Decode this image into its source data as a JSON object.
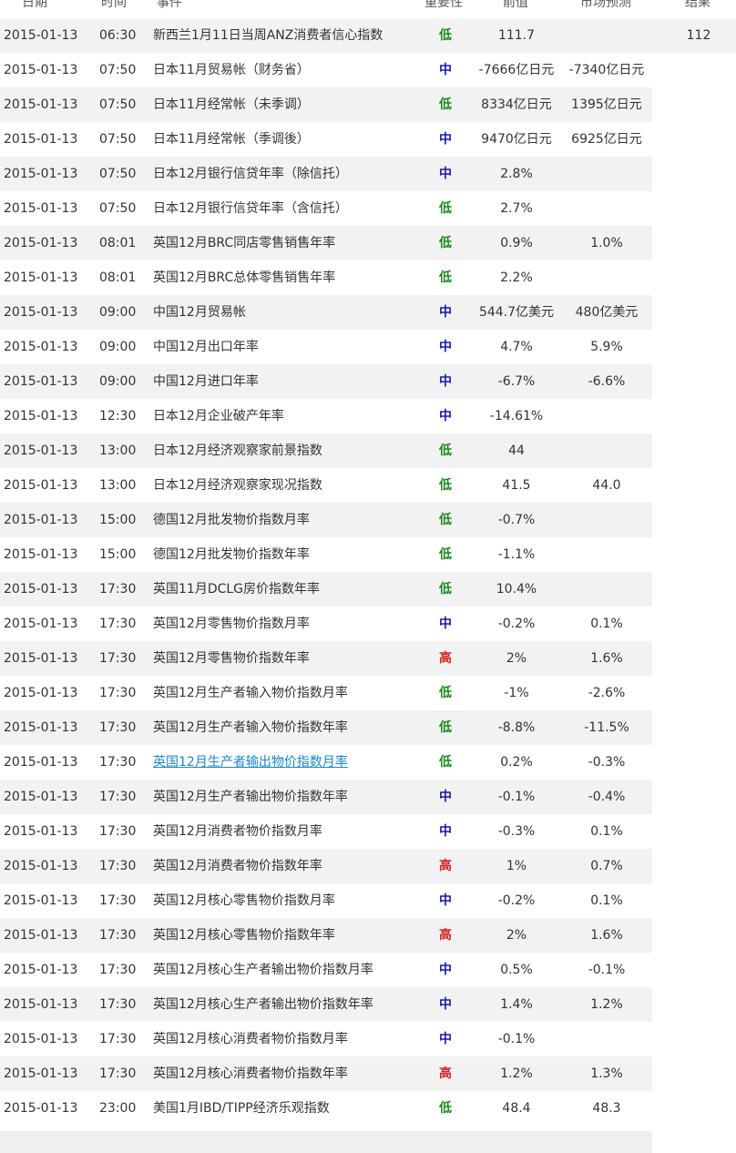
{
  "header": {
    "date": "日期",
    "time": "时间",
    "event": "事件",
    "importance": "重要性",
    "previous": "前值",
    "forecast": "市场预测",
    "actual": "结果"
  },
  "colors": {
    "low": "#1a8a1a",
    "mid": "#1a1aa6",
    "high": "#d42020",
    "link": "#1a88c9",
    "stripe": "#f2f2f2"
  },
  "rows": [
    {
      "date": "2015-01-13",
      "time": "06:30",
      "event": "新西兰1月11日当周ANZ消费者信心指数",
      "importance": "低",
      "level": "low",
      "previous": "111.7",
      "forecast": "",
      "actual": "112"
    },
    {
      "date": "2015-01-13",
      "time": "07:50",
      "event": "日本11月贸易帐（财务省）",
      "importance": "中",
      "level": "mid",
      "previous": "-7666亿日元",
      "forecast": "-7340亿日元",
      "actual": ""
    },
    {
      "date": "2015-01-13",
      "time": "07:50",
      "event": "日本11月经常帐（未季调）",
      "importance": "低",
      "level": "low",
      "previous": "8334亿日元",
      "forecast": "1395亿日元",
      "actual": ""
    },
    {
      "date": "2015-01-13",
      "time": "07:50",
      "event": "日本11月经常帐（季调後）",
      "importance": "中",
      "level": "mid",
      "previous": "9470亿日元",
      "forecast": "6925亿日元",
      "actual": ""
    },
    {
      "date": "2015-01-13",
      "time": "07:50",
      "event": "日本12月银行信贷年率（除信托）",
      "importance": "中",
      "level": "mid",
      "previous": "2.8%",
      "forecast": "",
      "actual": ""
    },
    {
      "date": "2015-01-13",
      "time": "07:50",
      "event": "日本12月银行信贷年率（含信托）",
      "importance": "低",
      "level": "low",
      "previous": "2.7%",
      "forecast": "",
      "actual": ""
    },
    {
      "date": "2015-01-13",
      "time": "08:01",
      "event": "英国12月BRC同店零售销售年率",
      "importance": "低",
      "level": "low",
      "previous": "0.9%",
      "forecast": "1.0%",
      "actual": ""
    },
    {
      "date": "2015-01-13",
      "time": "08:01",
      "event": "英国12月BRC总体零售销售年率",
      "importance": "低",
      "level": "low",
      "previous": "2.2%",
      "forecast": "",
      "actual": ""
    },
    {
      "date": "2015-01-13",
      "time": "09:00",
      "event": "中国12月贸易帐",
      "importance": "中",
      "level": "mid",
      "previous": "544.7亿美元",
      "forecast": "480亿美元",
      "actual": ""
    },
    {
      "date": "2015-01-13",
      "time": "09:00",
      "event": "中国12月出口年率",
      "importance": "中",
      "level": "mid",
      "previous": "4.7%",
      "forecast": "5.9%",
      "actual": ""
    },
    {
      "date": "2015-01-13",
      "time": "09:00",
      "event": "中国12月进口年率",
      "importance": "中",
      "level": "mid",
      "previous": "-6.7%",
      "forecast": "-6.6%",
      "actual": ""
    },
    {
      "date": "2015-01-13",
      "time": "12:30",
      "event": "日本12月企业破产年率",
      "importance": "中",
      "level": "mid",
      "previous": "-14.61%",
      "forecast": "",
      "actual": ""
    },
    {
      "date": "2015-01-13",
      "time": "13:00",
      "event": "日本12月经济观察家前景指数",
      "importance": "低",
      "level": "low",
      "previous": "44",
      "forecast": "",
      "actual": ""
    },
    {
      "date": "2015-01-13",
      "time": "13:00",
      "event": "日本12月经济观察家现况指数",
      "importance": "低",
      "level": "low",
      "previous": "41.5",
      "forecast": "44.0",
      "actual": ""
    },
    {
      "date": "2015-01-13",
      "time": "15:00",
      "event": "德国12月批发物价指数月率",
      "importance": "低",
      "level": "low",
      "previous": "-0.7%",
      "forecast": "",
      "actual": ""
    },
    {
      "date": "2015-01-13",
      "time": "15:00",
      "event": "德国12月批发物价指数年率",
      "importance": "低",
      "level": "low",
      "previous": "-1.1%",
      "forecast": "",
      "actual": ""
    },
    {
      "date": "2015-01-13",
      "time": "17:30",
      "event": "英国11月DCLG房价指数年率",
      "importance": "低",
      "level": "low",
      "previous": "10.4%",
      "forecast": "",
      "actual": ""
    },
    {
      "date": "2015-01-13",
      "time": "17:30",
      "event": "英国12月零售物价指数月率",
      "importance": "中",
      "level": "mid",
      "previous": "-0.2%",
      "forecast": "0.1%",
      "actual": ""
    },
    {
      "date": "2015-01-13",
      "time": "17:30",
      "event": "英国12月零售物价指数年率",
      "importance": "高",
      "level": "high",
      "previous": "2%",
      "forecast": "1.6%",
      "actual": ""
    },
    {
      "date": "2015-01-13",
      "time": "17:30",
      "event": "英国12月生产者输入物价指数月率",
      "importance": "低",
      "level": "low",
      "previous": "-1%",
      "forecast": "-2.6%",
      "actual": ""
    },
    {
      "date": "2015-01-13",
      "time": "17:30",
      "event": "英国12月生产者输入物价指数年率",
      "importance": "低",
      "level": "low",
      "previous": "-8.8%",
      "forecast": "-11.5%",
      "actual": ""
    },
    {
      "date": "2015-01-13",
      "time": "17:30",
      "event": "英国12月生产者输出物价指数月率",
      "importance": "低",
      "level": "low",
      "previous": "0.2%",
      "forecast": "-0.3%",
      "actual": "",
      "link": true
    },
    {
      "date": "2015-01-13",
      "time": "17:30",
      "event": "英国12月生产者输出物价指数年率",
      "importance": "中",
      "level": "mid",
      "previous": "-0.1%",
      "forecast": "-0.4%",
      "actual": ""
    },
    {
      "date": "2015-01-13",
      "time": "17:30",
      "event": "英国12月消费者物价指数月率",
      "importance": "中",
      "level": "mid",
      "previous": "-0.3%",
      "forecast": "0.1%",
      "actual": ""
    },
    {
      "date": "2015-01-13",
      "time": "17:30",
      "event": "英国12月消费者物价指数年率",
      "importance": "高",
      "level": "high",
      "previous": "1%",
      "forecast": "0.7%",
      "actual": ""
    },
    {
      "date": "2015-01-13",
      "time": "17:30",
      "event": "英国12月核心零售物价指数月率",
      "importance": "中",
      "level": "mid",
      "previous": "-0.2%",
      "forecast": "0.1%",
      "actual": ""
    },
    {
      "date": "2015-01-13",
      "time": "17:30",
      "event": "英国12月核心零售物价指数年率",
      "importance": "高",
      "level": "high",
      "previous": "2%",
      "forecast": "1.6%",
      "actual": ""
    },
    {
      "date": "2015-01-13",
      "time": "17:30",
      "event": "英国12月核心生产者输出物价指数月率",
      "importance": "中",
      "level": "mid",
      "previous": "0.5%",
      "forecast": "-0.1%",
      "actual": ""
    },
    {
      "date": "2015-01-13",
      "time": "17:30",
      "event": "英国12月核心生产者输出物价指数年率",
      "importance": "中",
      "level": "mid",
      "previous": "1.4%",
      "forecast": "1.2%",
      "actual": ""
    },
    {
      "date": "2015-01-13",
      "time": "17:30",
      "event": "英国12月核心消费者物价指数月率",
      "importance": "中",
      "level": "mid",
      "previous": "-0.1%",
      "forecast": "",
      "actual": ""
    },
    {
      "date": "2015-01-13",
      "time": "17:30",
      "event": "英国12月核心消费者物价指数年率",
      "importance": "高",
      "level": "high",
      "previous": "1.2%",
      "forecast": "1.3%",
      "actual": ""
    },
    {
      "date": "2015-01-13",
      "time": "23:00",
      "event": "美国1月IBD/TIPP经济乐观指数",
      "importance": "低",
      "level": "low",
      "previous": "48.4",
      "forecast": "48.3",
      "actual": ""
    }
  ]
}
